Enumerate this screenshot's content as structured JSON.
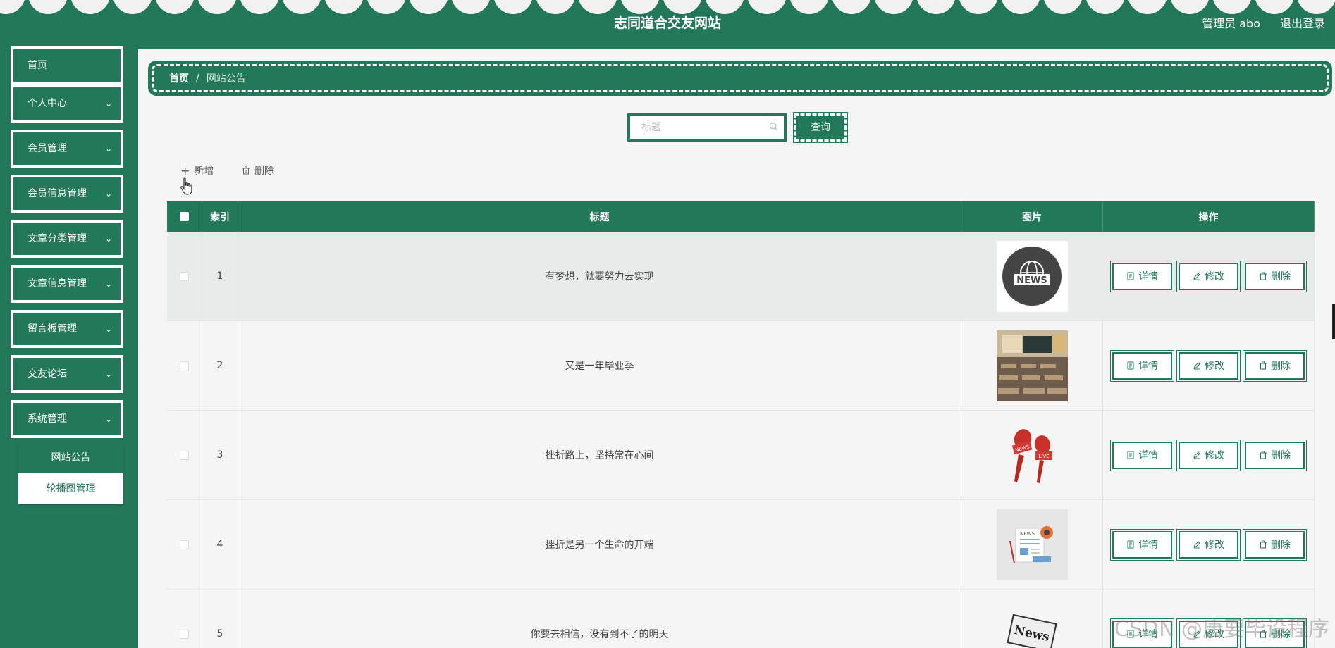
{
  "header": {
    "site_title": "志同道合交友网站",
    "admin_label": "管理员 abo",
    "logout_label": "退出登录"
  },
  "sidebar": {
    "items": [
      {
        "label": "首页",
        "has_chevron": false
      },
      {
        "label": "个人中心",
        "has_chevron": true
      },
      {
        "label": "会员管理",
        "has_chevron": true
      },
      {
        "label": "会员信息管理",
        "has_chevron": true
      },
      {
        "label": "文章分类管理",
        "has_chevron": true
      },
      {
        "label": "文章信息管理",
        "has_chevron": true
      },
      {
        "label": "留言板管理",
        "has_chevron": true
      },
      {
        "label": "交友论坛",
        "has_chevron": true
      },
      {
        "label": "系统管理",
        "has_chevron": true
      }
    ],
    "submenu": [
      {
        "label": "网站公告",
        "active": true
      },
      {
        "label": "轮播图管理",
        "active": false
      }
    ]
  },
  "breadcrumb": {
    "home": "首页",
    "separator": "/",
    "current": "网站公告"
  },
  "search": {
    "placeholder": "标题",
    "value": "",
    "button_label": "查询"
  },
  "toolbar": {
    "add_label": "新增",
    "delete_label": "删除"
  },
  "table": {
    "headers": {
      "index": "索引",
      "title": "标题",
      "image": "图片",
      "operations": "操作"
    },
    "rows": [
      {
        "index": "1",
        "title": "有梦想，就要努力去实现",
        "image": "news-globe-icon"
      },
      {
        "index": "2",
        "title": "又是一年毕业季",
        "image": "classroom-photo"
      },
      {
        "index": "3",
        "title": "挫折路上，坚持常在心间",
        "image": "news-microphone-icon"
      },
      {
        "index": "4",
        "title": "挫折是另一个生命的开端",
        "image": "newspaper-illustration"
      },
      {
        "index": "5",
        "title": "你要去相信，没有到不了的明天",
        "image": "news-paper-icon"
      }
    ],
    "actions": {
      "detail": "详情",
      "edit": "修改",
      "delete": "删除"
    }
  },
  "watermark": "CSDN @唐要毕设程序",
  "colors": {
    "primary": "#237859",
    "background": "#f4f5f4"
  }
}
